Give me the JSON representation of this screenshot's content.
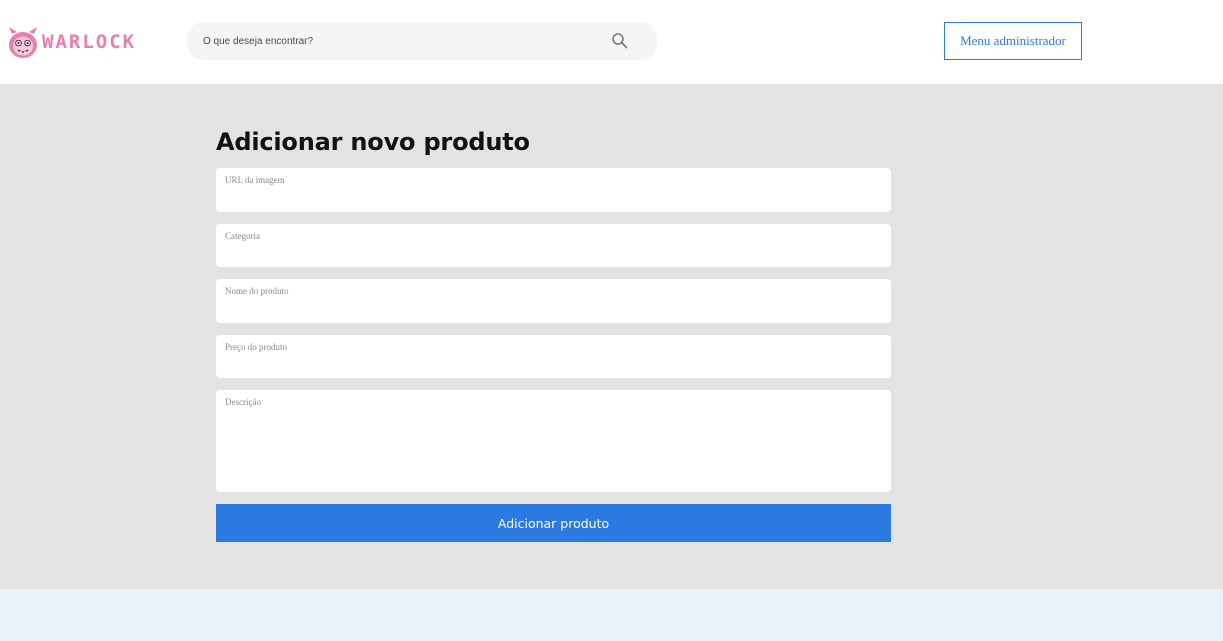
{
  "header": {
    "logo_text": "WARLOCK",
    "search": {
      "placeholder": "O que deseja encontrar?",
      "icon": "search-icon"
    },
    "admin_button_label": "Menu administrador"
  },
  "form": {
    "title": "Adicionar novo produto",
    "fields": [
      {
        "label": "URL da imagem",
        "value": ""
      },
      {
        "label": "Categoria",
        "value": ""
      },
      {
        "label": "Nome do produto",
        "value": ""
      },
      {
        "label": "Preço do produto",
        "value": ""
      },
      {
        "label": "Descrição",
        "value": ""
      }
    ],
    "submit_label": "Adicionar produto"
  },
  "colors": {
    "accent": "#2a7ae2",
    "logo": "#e77fb3",
    "main_bg": "#e3e3e3",
    "footer_bg": "#eaf1fb"
  }
}
